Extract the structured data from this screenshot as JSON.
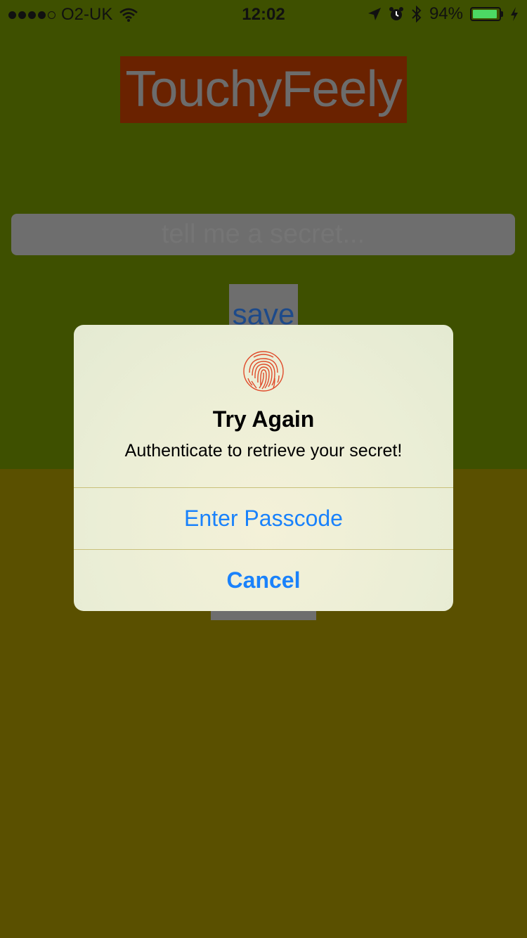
{
  "status_bar": {
    "carrier": "O2-UK",
    "time": "12:02",
    "battery_percent": "94%",
    "battery_level": 0.94,
    "signal_bars_filled": 4,
    "signal_bars_total": 5,
    "icons": [
      "wifi-icon",
      "location-arrow-icon",
      "alarm-icon",
      "bluetooth-icon",
      "charging-bolt-icon"
    ]
  },
  "app": {
    "title": "TouchyFeely",
    "secret_input": {
      "placeholder": "tell me a secret...",
      "value": ""
    },
    "save_label": "save"
  },
  "alert": {
    "icon": "fingerprint-icon",
    "title": "Try Again",
    "message": "Authenticate to retrieve your secret!",
    "buttons": {
      "enter_passcode": "Enter Passcode",
      "cancel": "Cancel"
    }
  },
  "colors": {
    "top_background": "#3e5000",
    "bottom_background": "#5a5000",
    "title_background": "#6a2200",
    "alert_button_text": "#1a82fb",
    "fingerprint": "#e04a2a",
    "battery_fill": "#4cd964"
  }
}
